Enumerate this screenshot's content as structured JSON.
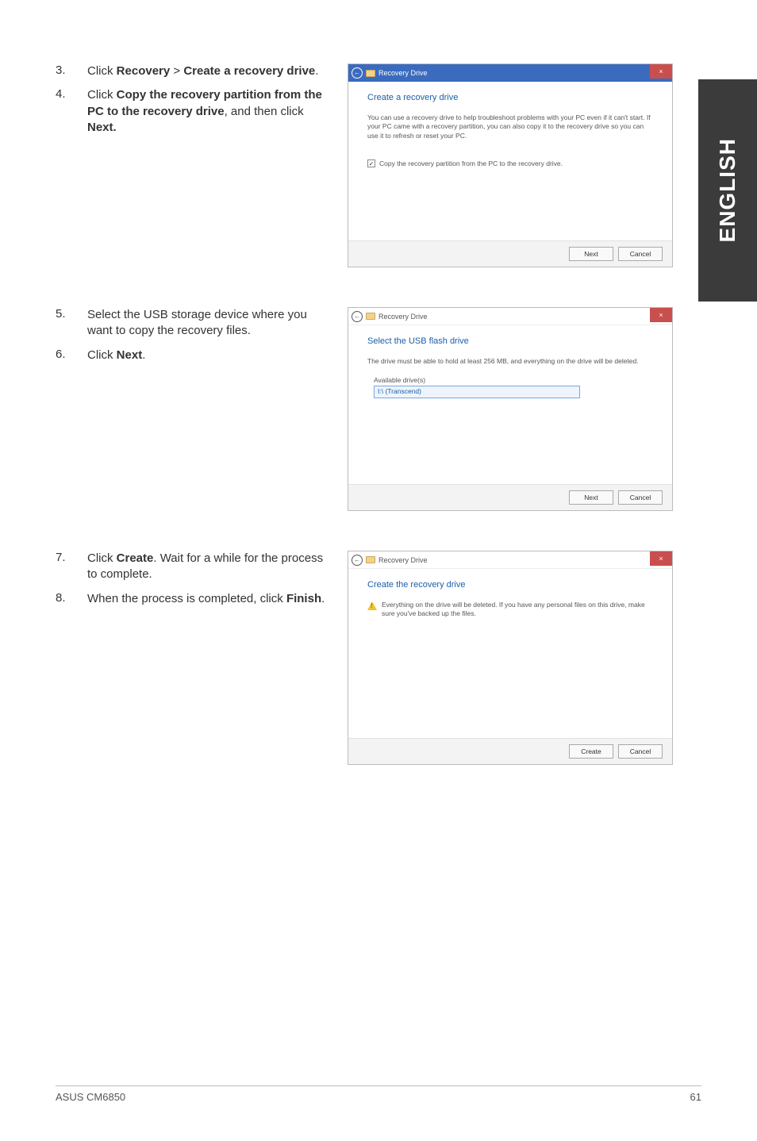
{
  "side_tab": "ENGLISH",
  "section1": {
    "steps": [
      {
        "num": "3.",
        "text_parts": [
          "Click ",
          "Recovery",
          " > ",
          "Create a recovery drive",
          "."
        ]
      },
      {
        "num": "4.",
        "text_parts": [
          "Click ",
          "Copy the recovery partition from the PC to the recovery drive",
          ", and then click ",
          "Next."
        ]
      }
    ],
    "dialog": {
      "back_glyph": "←",
      "title": "Recovery Drive",
      "close_glyph": "×",
      "heading": "Create a recovery drive",
      "body_text": "You can use a recovery drive to help troubleshoot problems with your PC even if it can't start. If your PC came with a recovery partition, you can also copy it to the recovery drive so you can use it to refresh or reset your PC.",
      "checkbox_glyph": "✓",
      "checkbox_label": "Copy the recovery partition from the PC to the recovery drive.",
      "btn_next": "Next",
      "btn_cancel": "Cancel"
    }
  },
  "section2": {
    "steps": [
      {
        "num": "5.",
        "text": "Select the USB storage device where you want to copy the recovery files."
      },
      {
        "num": "6.",
        "text_parts": [
          "Click ",
          "Next",
          "."
        ]
      }
    ],
    "dialog": {
      "back_glyph": "←",
      "title": "Recovery Drive",
      "close_glyph": "×",
      "heading": "Select the USB flash drive",
      "note": "The drive must be able to hold at least 256 MB, and everything on the drive will be deleted.",
      "available_label": "Available drive(s)",
      "drive_item": "I:\\ (Transcend)",
      "btn_next": "Next",
      "btn_cancel": "Cancel"
    }
  },
  "section3": {
    "steps": [
      {
        "num": "7.",
        "text_parts": [
          "Click ",
          "Create",
          ". Wait for a while for the process to complete."
        ]
      },
      {
        "num": "8.",
        "text_parts": [
          "When the process is completed, click ",
          "Finish",
          "."
        ]
      }
    ],
    "dialog": {
      "back_glyph": "←",
      "title": "Recovery Drive",
      "close_glyph": "×",
      "heading": "Create the recovery drive",
      "warn_text": "Everything on the drive will be deleted. If you have any personal files on this drive, make sure you've backed up the files.",
      "btn_create": "Create",
      "btn_cancel": "Cancel"
    }
  },
  "footer": {
    "left": "ASUS CM6850",
    "right": "61"
  }
}
